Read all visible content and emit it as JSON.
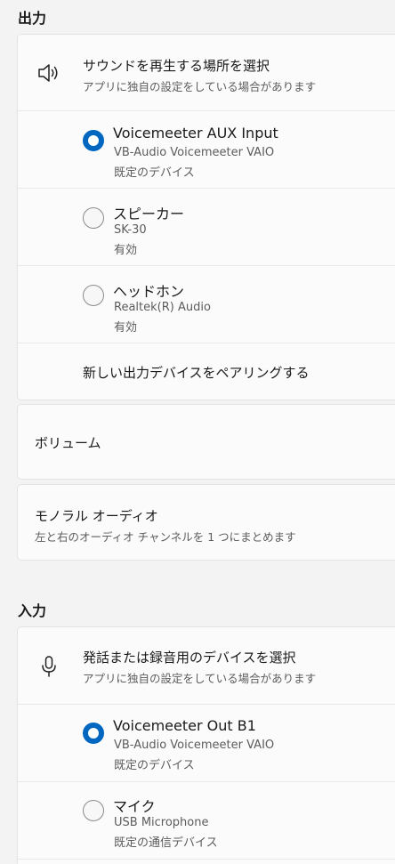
{
  "output": {
    "section_title": "出力",
    "choose": {
      "title": "サウンドを再生する場所を選択",
      "subtitle": "アプリに独自の設定をしている場合があります",
      "icon": "speaker-icon"
    },
    "devices": [
      {
        "name": "Voicemeeter AUX Input",
        "detail": "VB-Audio Voicemeeter VAIO",
        "status": "既定のデバイス",
        "selected": true
      },
      {
        "name": "スピーカー",
        "detail": "SK-30",
        "status": "有効",
        "selected": false
      },
      {
        "name": "ヘッドホン",
        "detail": "Realtek(R) Audio",
        "status": "有効",
        "selected": false
      }
    ],
    "pair_label": "新しい出力デバイスをペアリングする",
    "volume_label": "ボリューム",
    "mono": {
      "title": "モノラル オーディオ",
      "subtitle": "左と右のオーディオ チャンネルを 1 つにまとめます"
    }
  },
  "input": {
    "section_title": "入力",
    "choose": {
      "title": "発話または録音用のデバイスを選択",
      "subtitle": "アプリに独自の設定をしている場合があります",
      "icon": "microphone-icon"
    },
    "devices": [
      {
        "name": "Voicemeeter Out B1",
        "detail": "VB-Audio Voicemeeter VAIO",
        "status": "既定のデバイス",
        "selected": true
      },
      {
        "name": "マイク",
        "detail": "USB Microphone",
        "status": "既定の通信デバイス",
        "selected": false
      }
    ]
  },
  "colors": {
    "accent": "#0067c0",
    "background": "#f3f3f3",
    "card": "#fbfbfb"
  }
}
